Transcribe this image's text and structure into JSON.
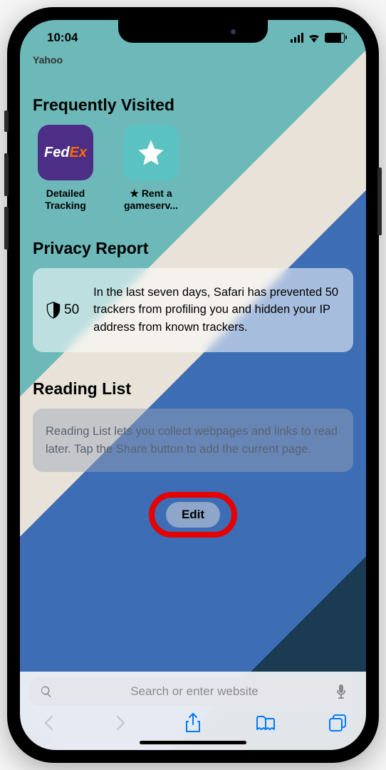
{
  "status": {
    "time": "10:04"
  },
  "cutoff_label": "Yahoo",
  "frequently_visited": {
    "title": "Frequently Visited",
    "items": [
      {
        "label": "Detailed Tracking",
        "icon": "fedex"
      },
      {
        "label": "★ Rent a gameserv...",
        "icon": "star"
      }
    ]
  },
  "privacy_report": {
    "title": "Privacy Report",
    "count": "50",
    "text": "In the last seven days, Safari has prevented 50 trackers from profiling you and hidden your IP address from known trackers."
  },
  "reading_list": {
    "title": "Reading List",
    "text": "Reading List lets you collect webpages and links to read later. Tap the Share button to add the current page."
  },
  "edit_button_label": "Edit",
  "search": {
    "placeholder": "Search or enter website"
  }
}
